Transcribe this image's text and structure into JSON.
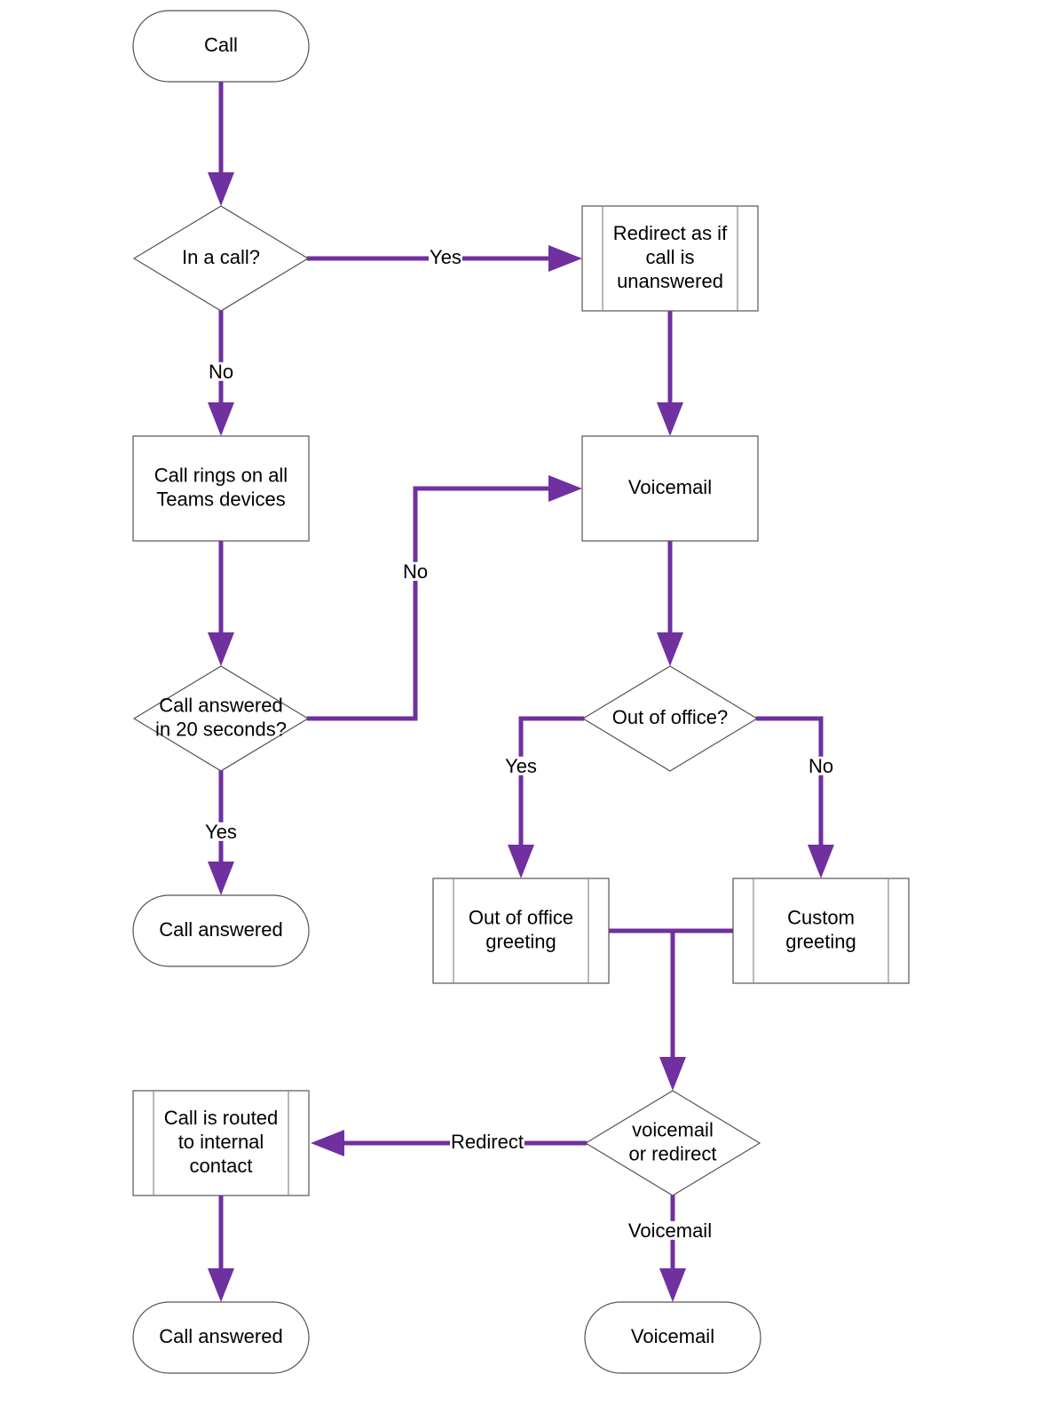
{
  "diagram": {
    "type": "flowchart",
    "colors": {
      "connector": "#7030A0",
      "shape_stroke": "#555555",
      "shape_fill": "#ffffff",
      "text": "#000000"
    },
    "nodes": {
      "start_call": {
        "shape": "terminator",
        "lines": [
          "Call"
        ]
      },
      "in_a_call": {
        "shape": "decision",
        "lines": [
          "In a call?"
        ]
      },
      "redirect_unanswered": {
        "shape": "predefined-process",
        "lines": [
          "Redirect as if",
          "call is",
          "unanswered"
        ]
      },
      "rings_all_devices": {
        "shape": "process",
        "lines": [
          "Call rings on all",
          "Teams devices"
        ]
      },
      "voicemail_box": {
        "shape": "process",
        "lines": [
          "Voicemail"
        ]
      },
      "answered_20s": {
        "shape": "decision",
        "lines": [
          "Call answered",
          "in 20 seconds?"
        ]
      },
      "out_of_office_q": {
        "shape": "decision",
        "lines": [
          "Out of office?"
        ]
      },
      "call_answered_1": {
        "shape": "terminator",
        "lines": [
          "Call answered"
        ]
      },
      "ooo_greeting": {
        "shape": "predefined-process",
        "lines": [
          "Out of office",
          "greeting"
        ]
      },
      "custom_greeting": {
        "shape": "predefined-process",
        "lines": [
          "Custom",
          "greeting"
        ]
      },
      "voicemail_or_redirect": {
        "shape": "decision",
        "lines": [
          "voicemail",
          "or redirect"
        ]
      },
      "routed_internal": {
        "shape": "predefined-process",
        "lines": [
          "Call is routed",
          "to internal",
          "contact"
        ]
      },
      "call_answered_2": {
        "shape": "terminator",
        "lines": [
          "Call answered"
        ]
      },
      "voicemail_end": {
        "shape": "terminator",
        "lines": [
          "Voicemail"
        ]
      }
    },
    "edges": [
      {
        "from": "start_call",
        "to": "in_a_call",
        "label": ""
      },
      {
        "from": "in_a_call",
        "to": "redirect_unanswered",
        "label": "Yes"
      },
      {
        "from": "in_a_call",
        "to": "rings_all_devices",
        "label": "No"
      },
      {
        "from": "redirect_unanswered",
        "to": "voicemail_box",
        "label": ""
      },
      {
        "from": "rings_all_devices",
        "to": "answered_20s",
        "label": ""
      },
      {
        "from": "answered_20s",
        "to": "voicemail_box",
        "label": "No"
      },
      {
        "from": "answered_20s",
        "to": "call_answered_1",
        "label": "Yes"
      },
      {
        "from": "voicemail_box",
        "to": "out_of_office_q",
        "label": ""
      },
      {
        "from": "out_of_office_q",
        "to": "ooo_greeting",
        "label": "Yes"
      },
      {
        "from": "out_of_office_q",
        "to": "custom_greeting",
        "label": "No"
      },
      {
        "from": "ooo_greeting",
        "to": "voicemail_or_redirect",
        "label": ""
      },
      {
        "from": "custom_greeting",
        "to": "voicemail_or_redirect",
        "label": ""
      },
      {
        "from": "voicemail_or_redirect",
        "to": "routed_internal",
        "label": "Redirect"
      },
      {
        "from": "voicemail_or_redirect",
        "to": "voicemail_end",
        "label": "Voicemail"
      },
      {
        "from": "routed_internal",
        "to": "call_answered_2",
        "label": ""
      }
    ]
  }
}
